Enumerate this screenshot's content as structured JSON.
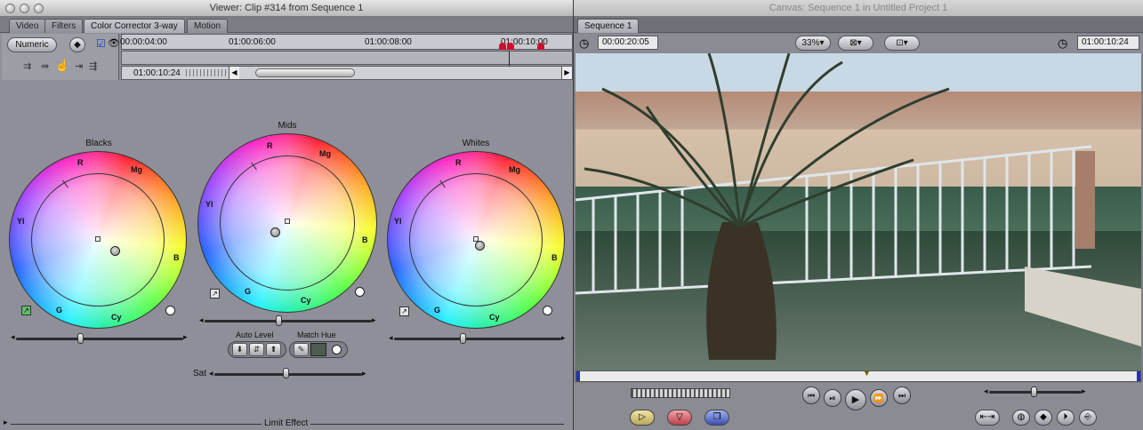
{
  "viewer": {
    "title": "Viewer: Clip #314 from Sequence 1",
    "tabs": [
      "Video",
      "Filters",
      "Color Corrector 3-way",
      "Motion"
    ],
    "numeric_label": "Numeric",
    "ruler_labels": [
      "00:00:04:00",
      "01:00:06:00",
      "01:00:08:00",
      "01:00:10:00"
    ],
    "timecode": "01:00:10:24",
    "wheels": [
      {
        "title": "Blacks",
        "labels": {
          "r": "R",
          "mg": "Mg",
          "yl": "Yl",
          "b": "B",
          "g": "G",
          "cy": "Cy"
        }
      },
      {
        "title": "Mids",
        "labels": {
          "r": "R",
          "mg": "Mg",
          "yl": "Yl",
          "b": "B",
          "g": "G",
          "cy": "Cy"
        }
      },
      {
        "title": "Whites",
        "labels": {
          "r": "R",
          "mg": "Mg",
          "yl": "Yl",
          "b": "B",
          "g": "G",
          "cy": "Cy"
        }
      }
    ],
    "auto_level_label": "Auto Level",
    "match_hue_label": "Match Hue",
    "sat_label": "Sat",
    "limit_effect_label": "Limit Effect"
  },
  "canvas": {
    "title": "Canvas: Sequence 1 in Untitled Project 1",
    "tab": "Sequence 1",
    "duration": "00:00:20:05",
    "zoom": "33%",
    "current_timecode": "01:00:10:24"
  }
}
